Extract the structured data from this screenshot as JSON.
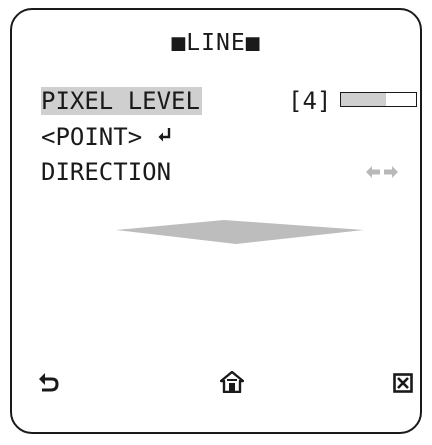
{
  "screen": {
    "title": "■LINE■"
  },
  "menu": {
    "items": [
      {
        "label": "PIXEL LEVEL",
        "selected": true
      },
      {
        "label": "<POINT>"
      },
      {
        "label": "DIRECTION"
      }
    ],
    "pixel_level": {
      "value_text": "[4]",
      "level_fraction": 0.6
    },
    "point_enter_icon": "enter-arrow-icon",
    "direction_icons": [
      "left-arrow-icon",
      "right-arrow-icon"
    ]
  },
  "preview": {
    "shape": "horizontal-line-diamond",
    "color": "#bdbdbd"
  },
  "bottom_bar": {
    "icons": [
      "back-icon",
      "home-icon",
      "close-icon"
    ]
  }
}
